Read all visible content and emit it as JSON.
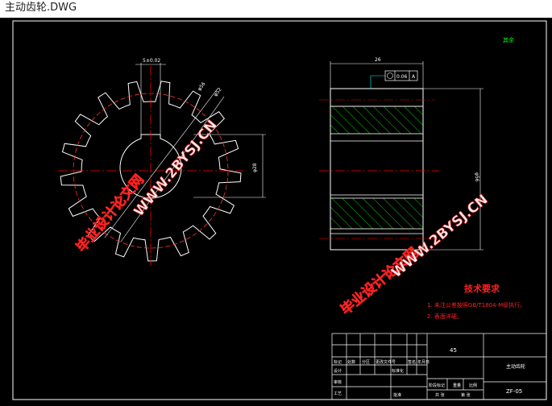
{
  "window": {
    "title": "主动齿轮.DWG"
  },
  "colors": {
    "background": "#000000",
    "frame": "#ffffff",
    "centerline": "#ff0000",
    "dimension": "#00ffff",
    "hatch": "#00ff00",
    "tolerance": "#00ffff",
    "watermark": "#e6e6e6",
    "watermark_outline": "#ff0000",
    "requirements": "#ff0000"
  },
  "drawing": {
    "roughness_note": "其余",
    "front_view": {
      "keyway_tolerance": "5±0.02",
      "outer_diameter": "φ56",
      "pitch_diameter": "φ52",
      "bore_dimension": "φ28"
    },
    "side_view": {
      "width": "26",
      "tolerance_value": "0.06",
      "datum": "A",
      "height_dimension": "φ56"
    },
    "tech_requirements": {
      "title": "技术要求",
      "items": [
        "1. 未注公差按照GB/T1804-M级执行。",
        "2. 表面淬硬。"
      ]
    },
    "title_block": {
      "material": "45",
      "part_name": "主动齿轮",
      "drawing_number": "ZF-05",
      "header_cells": [
        "标记",
        "处数",
        "分区",
        "更改文件号",
        "签名",
        "年月日"
      ],
      "design_row": [
        "设计",
        "",
        "",
        "标准化",
        "",
        ""
      ],
      "stage_labels": [
        "阶段标记",
        "重量",
        "比例"
      ],
      "review_label": "审核",
      "process_label": "工艺",
      "approve_label": "批准",
      "sheet_total": "共 张",
      "sheet_no": "第 张"
    }
  },
  "watermark": {
    "cn_text": "毕业设计论文网",
    "url_text": "WWW.2BYSJ.CN"
  }
}
